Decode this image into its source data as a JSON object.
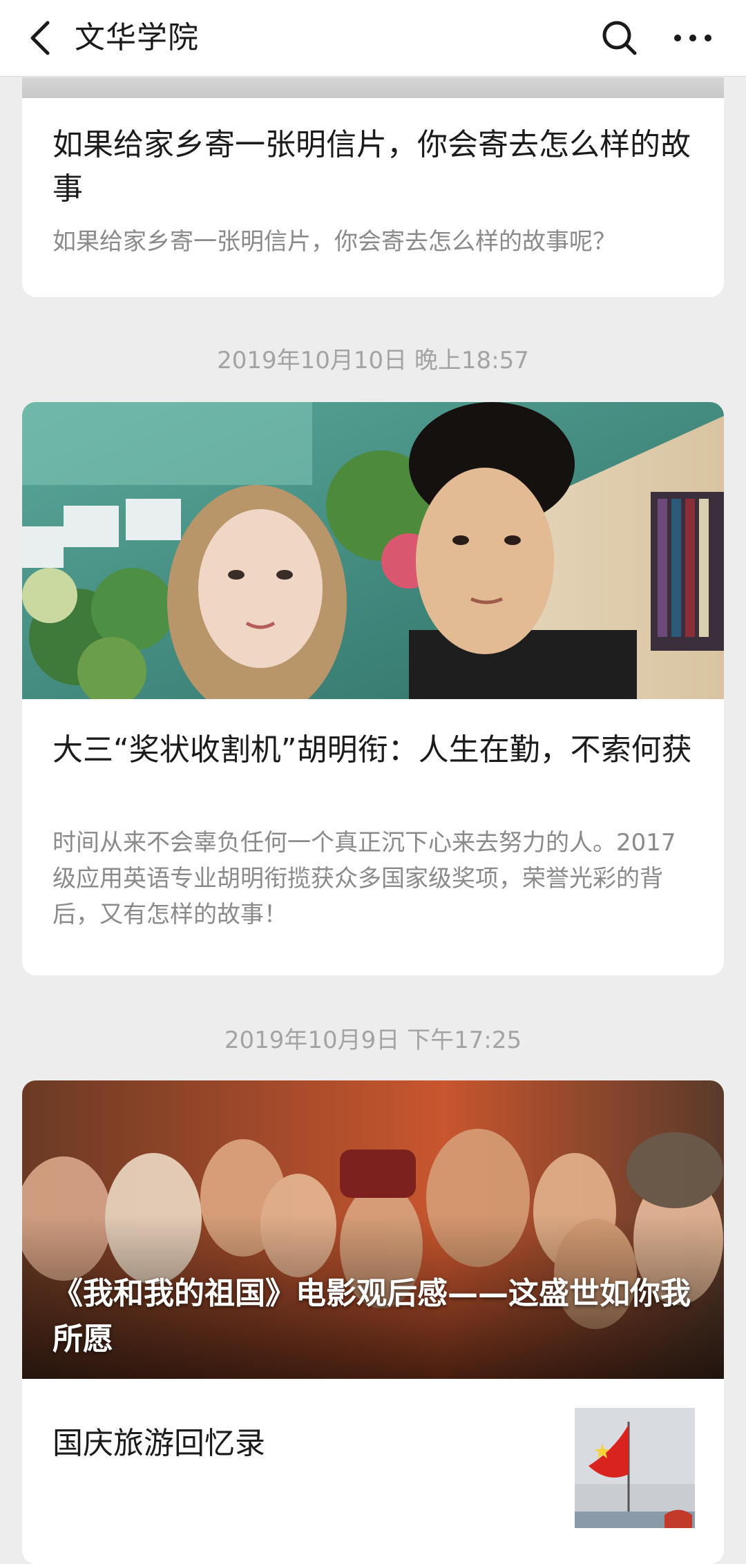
{
  "header": {
    "title": "文华学院",
    "back_icon": "chevron-left-icon",
    "search_icon": "search-icon",
    "more_icon": "more-horizontal-icon"
  },
  "articles": [
    {
      "title": "如果给家乡寄一张明信片，你会寄去怎么样的故事",
      "summary": "如果给家乡寄一张明信片，你会寄去怎么样的故事呢？"
    },
    {
      "timestamp": "2019年10月10日 晚上18:57",
      "title": "大三“奖状收割机”胡明衔：人生在勤，不索何获",
      "summary": "时间从来不会辜负任何一个真正沉下心来去努力的人。2017 级应用英语专业胡明衔揽获众多国家级奖项，荣誉光彩的背后，又有怎样的故事！"
    },
    {
      "timestamp": "2019年10月9日 下午17:25",
      "banner_title": "《我和我的祖国》电影观后感——这盛世如你我所愿",
      "sub_items": [
        {
          "title": "国庆旅游回忆录"
        }
      ]
    }
  ],
  "colors": {
    "background": "#ededed",
    "card": "#ffffff",
    "title_text": "#1b1b1b",
    "summary_text": "#8a8a8a",
    "timestamp_text": "#a3a3a3"
  }
}
